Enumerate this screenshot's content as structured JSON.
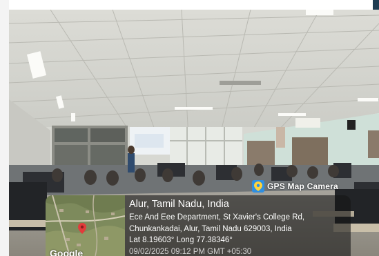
{
  "badge": {
    "app_name": "GPS Map Camera",
    "icon": "gps-map-camera-app-icon"
  },
  "location": {
    "title": "Alur, Tamil Nadu, India",
    "address_line_1": "Ece And Eee Department, St Xavier's College Rd,",
    "address_line_2": "Chunkankadai, Alur, Tamil Nadu 629003, India",
    "coordinates": "Lat 8.19603° Long 77.38346°",
    "datetime_partial": "09/02/2025 09:12 PM GMT +05:30"
  },
  "map": {
    "logo_text": "Google",
    "marker_icon": "location-pin-icon"
  },
  "colors": {
    "overlay": "#141414",
    "badge_blue": "#2f8ee0",
    "pin_red": "#e23b3b"
  }
}
